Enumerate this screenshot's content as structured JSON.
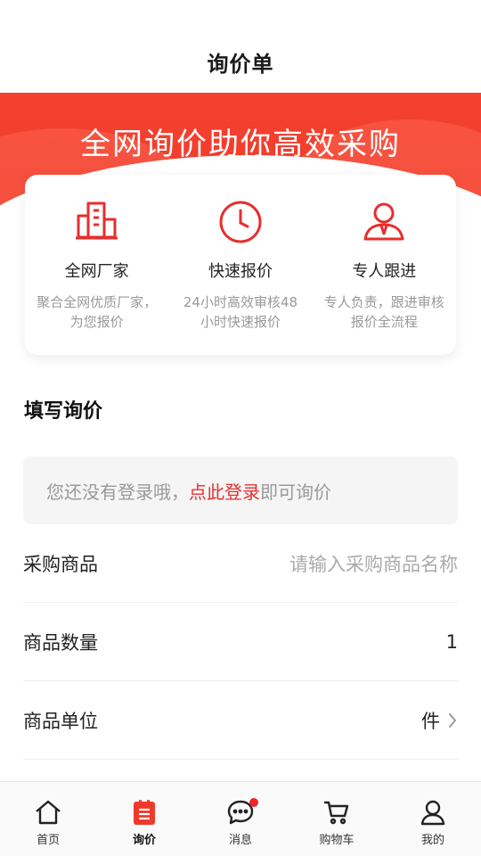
{
  "header": {
    "title": "询价单"
  },
  "banner": {
    "headline": "全网询价助你高效采购"
  },
  "features": [
    {
      "title": "全网厂家",
      "desc": "聚合全网优质厂家，为您报价",
      "icon": "building-icon"
    },
    {
      "title": "快速报价",
      "desc": "24小时高效审核48小时快速报价",
      "icon": "clock-icon"
    },
    {
      "title": "专人跟进",
      "desc": "专人负责，跟进审核报价全流程",
      "icon": "agent-icon"
    }
  ],
  "form": {
    "section_title": "填写询价",
    "login_tip": {
      "prefix": "您还没有登录哦，",
      "link": "点此登录",
      "suffix": "即可询价"
    },
    "product": {
      "label": "采购商品",
      "placeholder": "请输入采购商品名称"
    },
    "quantity": {
      "label": "商品数量",
      "value": "1"
    },
    "unit": {
      "label": "商品单位",
      "value": "件"
    }
  },
  "tabbar": [
    {
      "label": "首页",
      "icon": "home-icon"
    },
    {
      "label": "询价",
      "icon": "inquiry-icon",
      "active": true
    },
    {
      "label": "消息",
      "icon": "message-icon",
      "badge": true
    },
    {
      "label": "购物车",
      "icon": "cart-icon"
    },
    {
      "label": "我的",
      "icon": "profile-icon"
    }
  ],
  "colors": {
    "accent": "#e62e2e",
    "banner": "#f0392b",
    "badge": "#f0242b"
  }
}
